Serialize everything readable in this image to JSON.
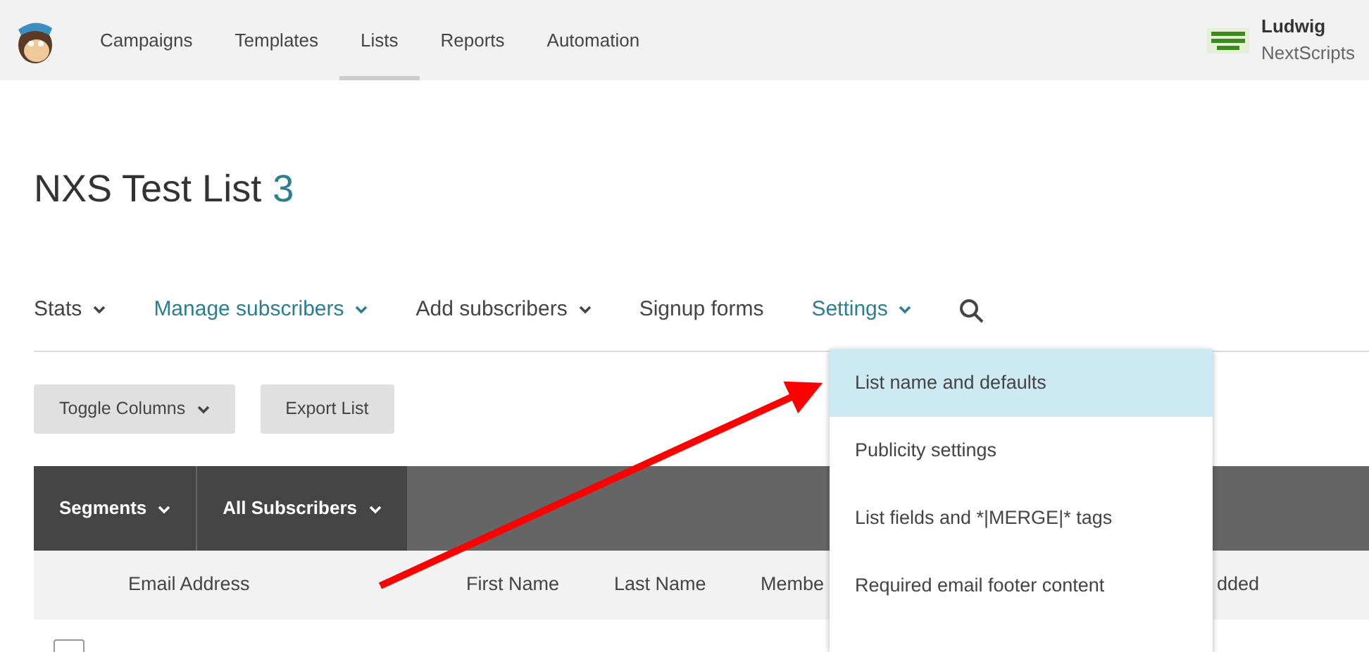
{
  "top_nav": [
    {
      "label": "Campaigns",
      "selected": false
    },
    {
      "label": "Templates",
      "selected": false
    },
    {
      "label": "Lists",
      "selected": true
    },
    {
      "label": "Reports",
      "selected": false
    },
    {
      "label": "Automation",
      "selected": false
    }
  ],
  "account": {
    "name": "Ludwig",
    "company": "NextScripts"
  },
  "list_title": {
    "name": "NXS Test List",
    "count": "3"
  },
  "list_tabs": [
    {
      "label": "Stats",
      "dropdown": true,
      "active": false
    },
    {
      "label": "Manage subscribers",
      "dropdown": true,
      "active": true
    },
    {
      "label": "Add subscribers",
      "dropdown": true,
      "active": false
    },
    {
      "label": "Signup forms",
      "dropdown": false,
      "active": false
    },
    {
      "label": "Settings",
      "dropdown": true,
      "active": true
    }
  ],
  "settings_menu": [
    {
      "label": "List name and defaults",
      "selected": true
    },
    {
      "label": "Publicity settings",
      "selected": false
    },
    {
      "label": "List fields and *|MERGE|* tags",
      "selected": false
    },
    {
      "label": "Required email footer content",
      "selected": false
    }
  ],
  "toolbar_buttons": [
    {
      "label": "Toggle Columns",
      "dropdown": true
    },
    {
      "label": "Export List",
      "dropdown": false
    }
  ],
  "segment_bar": [
    {
      "label": "Segments"
    },
    {
      "label": "All Subscribers"
    }
  ],
  "table": {
    "columns": [
      "Email Address",
      "First Name",
      "Last Name",
      "Membe",
      "dded"
    ],
    "rows": [
      {
        "checked": false
      }
    ]
  }
}
